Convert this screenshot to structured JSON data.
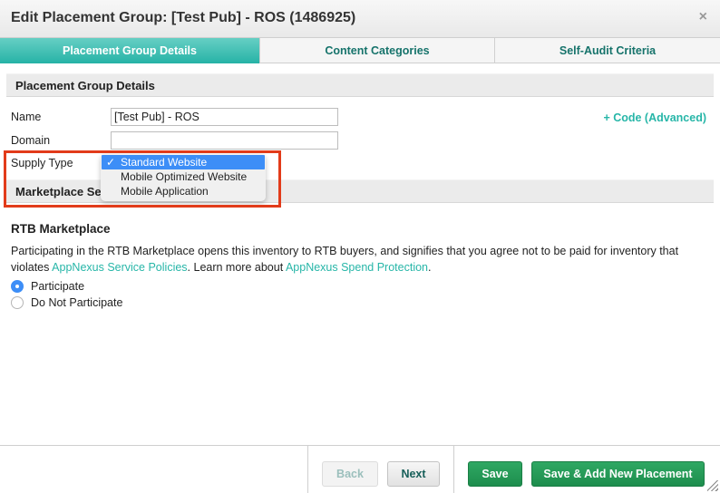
{
  "dialog": {
    "title": "Edit Placement Group: [Test Pub] - ROS (1486925)",
    "close_icon": "×"
  },
  "tabs": [
    {
      "label": "Placement Group Details",
      "active": true
    },
    {
      "label": "Content Categories",
      "active": false
    },
    {
      "label": "Self-Audit Criteria",
      "active": false
    }
  ],
  "details_section": {
    "header": "Placement Group Details",
    "name_label": "Name",
    "name_value": "[Test Pub] - ROS",
    "domain_label": "Domain",
    "domain_value": "",
    "supply_type_label": "Supply Type",
    "code_link": "+ Code (Advanced)"
  },
  "supply_type_dropdown": {
    "selected": "Standard Website",
    "check_icon": "✓",
    "options": [
      "Standard Website",
      "Mobile Optimized Website",
      "Mobile Application"
    ]
  },
  "marketplace_section": {
    "header": "Marketplace Se",
    "subtitle": "RTB Marketplace",
    "text_before": "Participating in the RTB Marketplace opens this inventory to RTB buyers, and signifies that you agree not to be paid for inventory that violates ",
    "link1": "AppNexus Service Policies",
    "text_middle": ". Learn more about ",
    "link2": "AppNexus Spend Protection",
    "text_after": ".",
    "radio_options": [
      {
        "label": "Participate",
        "checked": true
      },
      {
        "label": "Do Not Participate",
        "checked": false
      }
    ]
  },
  "footer": {
    "back_label": "Back",
    "next_label": "Next",
    "save_label": "Save",
    "save_add_label": "Save & Add New Placement"
  },
  "colors": {
    "accent_teal": "#27b6a8",
    "save_green": "#1d8d4d",
    "highlight_red": "#e23b1a",
    "select_blue": "#3d8ef7"
  }
}
